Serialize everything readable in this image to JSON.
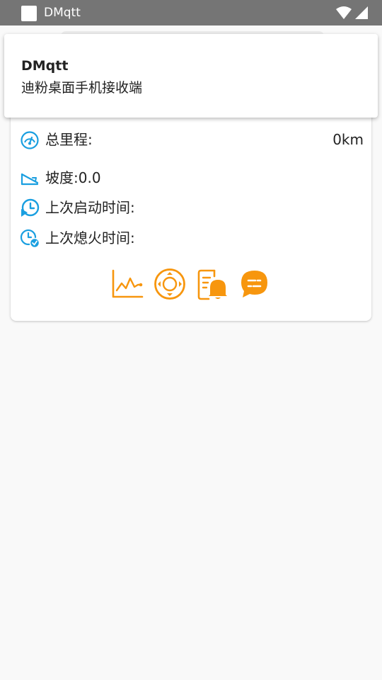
{
  "status_bar": {
    "app_name": "DMqtt"
  },
  "notification": {
    "title": "DMqtt",
    "text": "迪粉桌面手机接收端"
  },
  "vehicle_info": {
    "total_mileage_label": "总里程:",
    "total_mileage_value": "0km",
    "slope_label": "坡度:",
    "slope_value": "0.0",
    "last_start_label": "上次启动时间:",
    "last_stop_label": "上次熄火时间:"
  },
  "icons": {
    "mileage": "speedometer-icon",
    "slope": "slope-icon",
    "last_start": "clock-play-icon",
    "last_stop": "clock-check-icon",
    "chart": "line-chart-icon",
    "control": "direction-pad-icon",
    "alerts": "alert-bell-icon",
    "chat": "chat-bubble-icon"
  },
  "colors": {
    "status_bar": "#757575",
    "info_icon": "#1a9fe0",
    "action_icon": "#f7960e",
    "background": "#f9f9f9"
  }
}
